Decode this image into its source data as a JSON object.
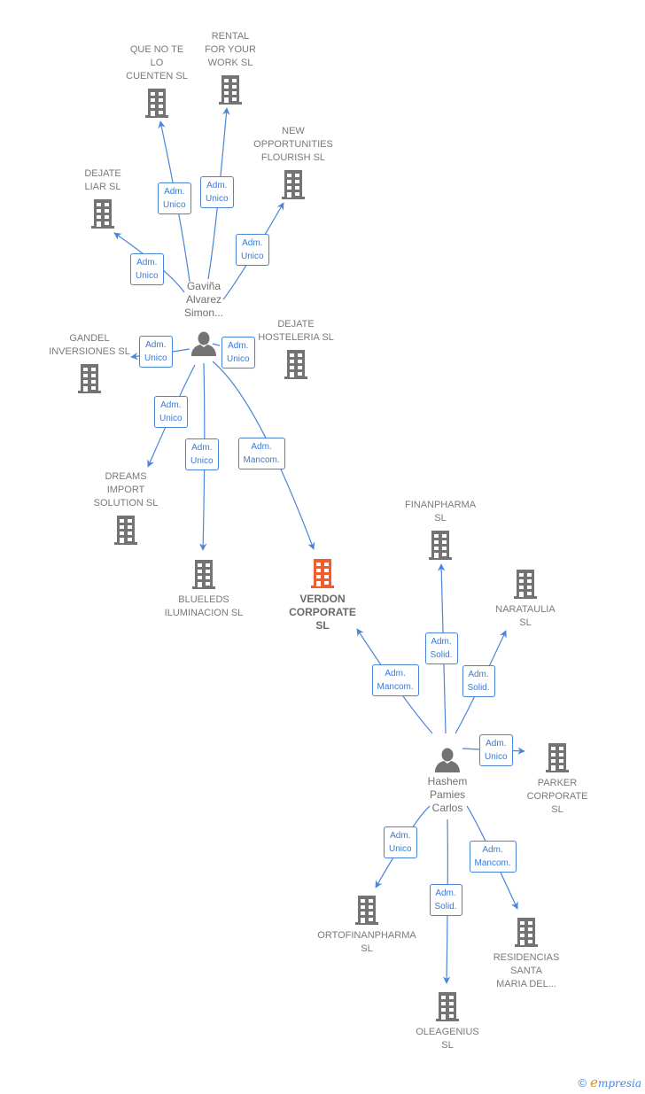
{
  "colors": {
    "edge": "#4a86d8",
    "company": "#737373",
    "focus_company": "#f25c2b",
    "person": "#737373",
    "label_text": "#7a7a7a"
  },
  "persons": [
    {
      "id": "p1",
      "name": "Gaviña\nAlvarez\nSimon...",
      "icon": "person-icon"
    },
    {
      "id": "p2",
      "name": "Hashem\nPamies\nCarlos",
      "icon": "person-icon"
    }
  ],
  "companies": [
    {
      "id": "c_quenote",
      "name": "QUE NO TE\nLO\nCUENTEN SL",
      "icon": "building-icon"
    },
    {
      "id": "c_rental",
      "name": "RENTAL\nFOR YOUR\nWORK  SL",
      "icon": "building-icon"
    },
    {
      "id": "c_newopp",
      "name": "NEW\nOPPORTUNITIES\nFLOURISH  SL",
      "icon": "building-icon"
    },
    {
      "id": "c_dejateliar",
      "name": "DEJATE\nLIAR SL",
      "icon": "building-icon"
    },
    {
      "id": "c_gandel",
      "name": "GANDEL\nINVERSIONES SL",
      "icon": "building-icon"
    },
    {
      "id": "c_dejatehost",
      "name": "DEJATE\nHOSTELERIA SL",
      "icon": "building-icon"
    },
    {
      "id": "c_dreams",
      "name": "DREAMS\nIMPORT\nSOLUTION  SL",
      "icon": "building-icon"
    },
    {
      "id": "c_blueleds",
      "name": "BLUELEDS\nILUMINACION SL",
      "icon": "building-icon"
    },
    {
      "id": "c_verdon",
      "name": "VERDON\nCORPORATE\nSL",
      "icon": "building-icon",
      "focus": true
    },
    {
      "id": "c_finanpharma",
      "name": "FINANPHARMA\nSL",
      "icon": "building-icon"
    },
    {
      "id": "c_narataulia",
      "name": "NARATAULIA\nSL",
      "icon": "building-icon"
    },
    {
      "id": "c_parker",
      "name": "PARKER\nCORPORATE\nSL",
      "icon": "building-icon"
    },
    {
      "id": "c_ortofin",
      "name": "ORTOFINANPHARMA\nSL",
      "icon": "building-icon"
    },
    {
      "id": "c_oleagenius",
      "name": "OLEAGENIUS\nSL",
      "icon": "building-icon"
    },
    {
      "id": "c_residencias",
      "name": "RESIDENCIAS\nSANTA\nMARIA DEL...",
      "icon": "building-icon"
    }
  ],
  "edges": [
    {
      "from": "p1",
      "to": "c_quenote",
      "label": "Adm.\nUnico"
    },
    {
      "from": "p1",
      "to": "c_rental",
      "label": "Adm.\nUnico"
    },
    {
      "from": "p1",
      "to": "c_newopp",
      "label": "Adm.\nUnico"
    },
    {
      "from": "p1",
      "to": "c_dejateliar",
      "label": "Adm.\nUnico"
    },
    {
      "from": "p1",
      "to": "c_gandel",
      "label": "Adm.\nUnico"
    },
    {
      "from": "p1",
      "to": "c_dejatehost",
      "label": "Adm.\nUnico"
    },
    {
      "from": "p1",
      "to": "c_dreams",
      "label": "Adm.\nUnico"
    },
    {
      "from": "p1",
      "to": "c_blueleds",
      "label": "Adm.\nUnico"
    },
    {
      "from": "p1",
      "to": "c_verdon",
      "label": "Adm.\nMancom."
    },
    {
      "from": "p2",
      "to": "c_verdon",
      "label": "Adm.\nMancom."
    },
    {
      "from": "p2",
      "to": "c_finanpharma",
      "label": "Adm.\nSolid."
    },
    {
      "from": "p2",
      "to": "c_narataulia",
      "label": "Adm.\nSolid."
    },
    {
      "from": "p2",
      "to": "c_parker",
      "label": "Adm.\nUnico"
    },
    {
      "from": "p2",
      "to": "c_ortofin",
      "label": "Adm.\nUnico"
    },
    {
      "from": "p2",
      "to": "c_oleagenius",
      "label": "Adm.\nSolid."
    },
    {
      "from": "p2",
      "to": "c_residencias",
      "label": "Adm.\nMancom."
    }
  ],
  "footer": {
    "copyright_symbol": "©",
    "brand_initial": "e",
    "brand_rest": "mpresia"
  }
}
